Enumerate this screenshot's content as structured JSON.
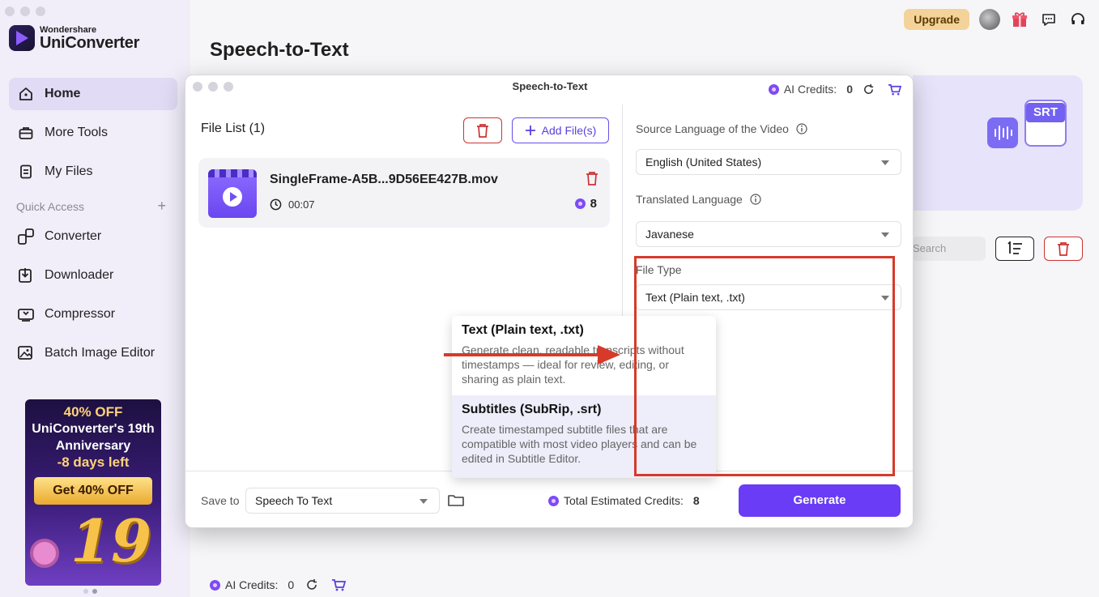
{
  "app": {
    "brand_small": "Wondershare",
    "brand_big": "UniConverter",
    "page_title": "Speech-to-Text"
  },
  "sidebar": {
    "items": [
      {
        "label": "Home",
        "icon": "home-icon"
      },
      {
        "label": "More Tools",
        "icon": "toolbox-icon"
      },
      {
        "label": "My Files",
        "icon": "file-icon"
      }
    ],
    "quick_access_label": "Quick Access",
    "quick_add": "+",
    "quick_items": [
      {
        "label": "Converter",
        "icon": "converter-icon"
      },
      {
        "label": "Downloader",
        "icon": "download-icon"
      },
      {
        "label": "Compressor",
        "icon": "compress-icon"
      },
      {
        "label": "Batch Image Editor",
        "icon": "image-edit-icon"
      }
    ]
  },
  "promo": {
    "line1": "40% OFF",
    "line2": "UniConverter's 19th",
    "line3": "Anniversary",
    "line4": "-8 days left",
    "button": "Get 40% OFF",
    "badge": "19"
  },
  "topbar": {
    "upgrade": "Upgrade"
  },
  "hero": {
    "tag": "SRT"
  },
  "list_toolbar": {
    "search_placeholder": "Search"
  },
  "footer": {
    "credits_label": "AI Credits:",
    "credits_value": "0"
  },
  "dialog": {
    "title": "Speech-to-Text",
    "credits_label": "AI Credits:",
    "credits_value": "0",
    "file_list_title": "File List (1)",
    "add_files": "Add File(s)",
    "file": {
      "name": "SingleFrame-A5B...9D56EE427B.mov",
      "duration": "00:07",
      "credits": "8"
    },
    "source_language_label": "Source Language of the Video",
    "source_language_value": "English (United States)",
    "translated_language_label": "Translated Language",
    "translated_language_value": "Javanese",
    "file_type_label": "File Type",
    "file_type_value": "Text (Plain text, .txt)",
    "file_type_options": [
      {
        "title": "Text (Plain text, .txt)",
        "desc": "Generate clean, readable transcripts without timestamps — ideal for review, editing, or sharing as plain text."
      },
      {
        "title": "Subtitles (SubRip, .srt)",
        "desc": "Create timestamped subtitle files that are compatible with most video players and can be edited in Subtitle Editor."
      }
    ],
    "save_to_label": "Save to",
    "save_to_value": "Speech To Text",
    "total_label": "Total Estimated Credits:",
    "total_value": "8",
    "generate": "Generate"
  },
  "colors": {
    "accent": "#6a3cf5",
    "highlight_box": "#d63a2a",
    "sidebar_bg": "#f1eefa"
  }
}
